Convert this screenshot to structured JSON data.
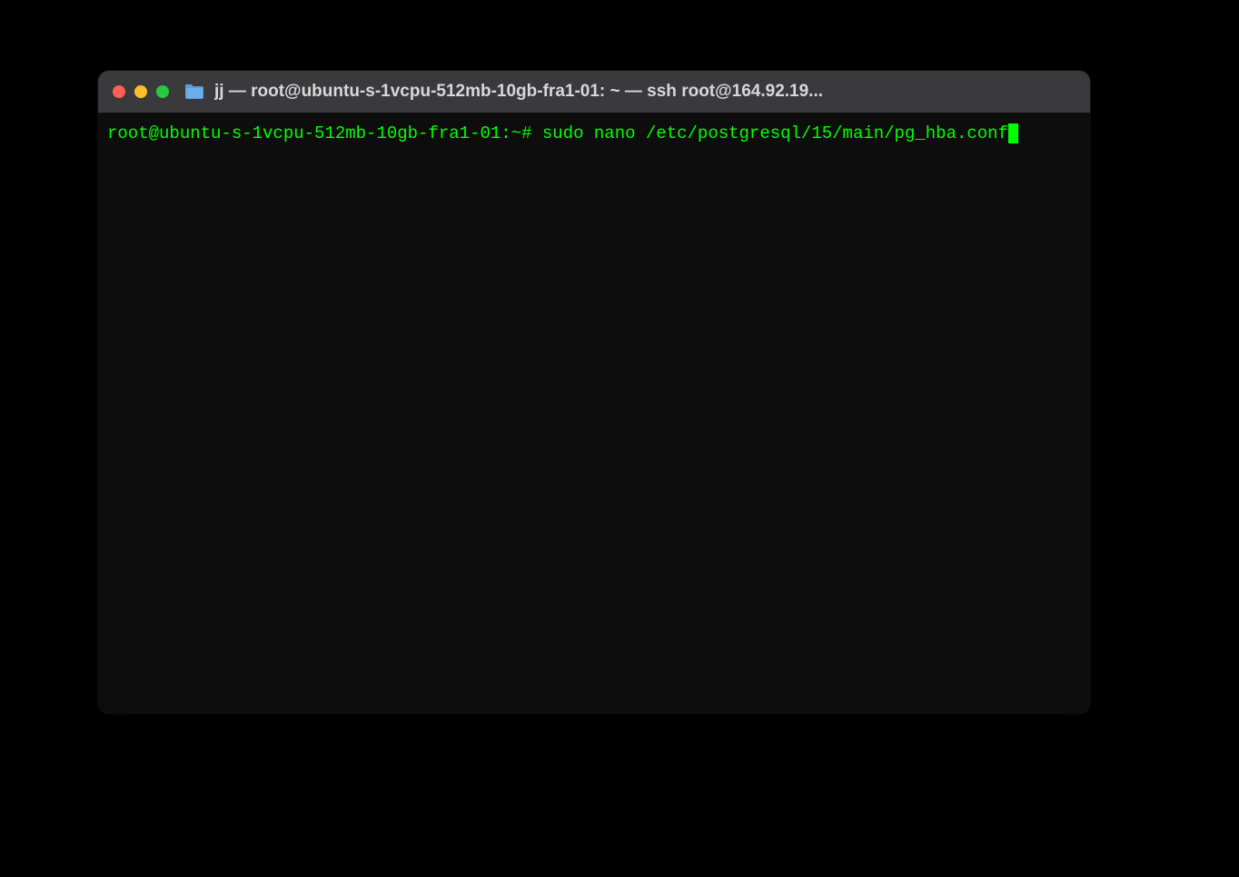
{
  "window": {
    "title": "jj — root@ubuntu-s-1vcpu-512mb-10gb-fra1-01: ~ — ssh root@164.92.19..."
  },
  "terminal": {
    "prompt": "root@ubuntu-s-1vcpu-512mb-10gb-fra1-01:~#",
    "command": "sudo nano /etc/postgresql/15/main/pg_hba.conf"
  }
}
